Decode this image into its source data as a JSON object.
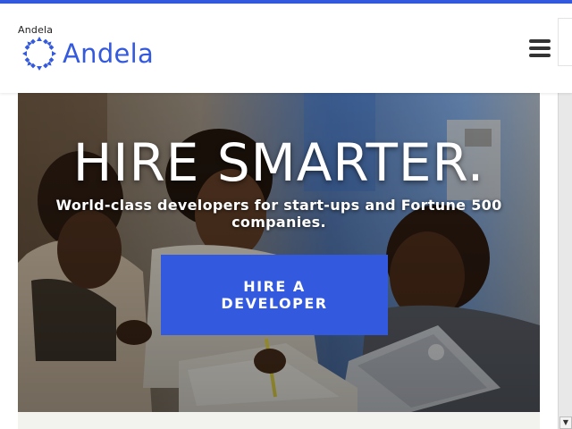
{
  "header": {
    "logo_alt": "Andela",
    "logo_text": "Andela",
    "menu_icon": "hamburger-icon"
  },
  "hero": {
    "title": "HIRE SMARTER.",
    "subtitle": "World-class developers for start-ups and Fortune 500 companies.",
    "cta_label": "HIRE A DEVELOPER"
  },
  "colors": {
    "brand": "#3359df",
    "top_bar": "#3359df"
  },
  "icons": {
    "logo_mark": "andela-logo-icon",
    "scroll_down": "scroll-down-arrow-icon"
  }
}
